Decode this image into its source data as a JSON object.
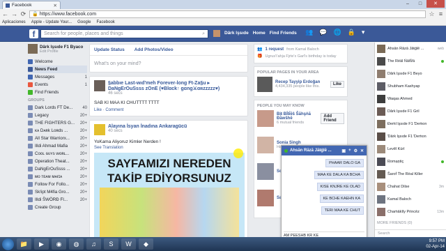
{
  "browser": {
    "tab_title": "Facebook",
    "url": "https://www.facebook.com",
    "bookmarks": [
      "Aplicaciones",
      "Apple - Update Your...",
      "Google",
      "Facebook"
    ]
  },
  "fb_header": {
    "search_placeholder": "Search for people, places and things",
    "user_name": "Dârk lşsıde",
    "home": "Home",
    "find_friends": "Find Friends"
  },
  "left": {
    "profile_name": "Dârk lşsıde F1 Byaco",
    "edit_profile": "Edit Profile",
    "items": [
      {
        "label": "Welcome",
        "count": ""
      },
      {
        "label": "News Feed",
        "count": "",
        "selected": true
      },
      {
        "label": "Messages",
        "count": "1"
      },
      {
        "label": "Events",
        "count": "1"
      },
      {
        "label": "Find Friends",
        "count": ""
      }
    ],
    "groups_title": "GROUPS",
    "groups": [
      {
        "label": "Dark Lords FT De...",
        "count": "40"
      },
      {
        "label": "Legacy",
        "count": "20+"
      },
      {
        "label": "THE FIGHTERS G...",
        "count": "20+"
      },
      {
        "label": "ᴋᴀ Dᴀʀk Lᴏʀds ...",
        "count": "20+"
      },
      {
        "label": "All Star Warriorx...",
        "count": "20+"
      },
      {
        "label": "Illdi Ahmad Mafia",
        "count": "20+"
      },
      {
        "label": "Cᴏᴏʟ ɢᴜʏs ᴡᴏʀʟ...",
        "count": "20+"
      },
      {
        "label": "Operation Theat...",
        "count": "20+"
      },
      {
        "label": "DaNgErOuSsss ...",
        "count": "20+"
      },
      {
        "label": "ᴍᴏ ᴛᴇᴀᴍ ᴍᴀғɪᴀ",
        "count": "20+"
      },
      {
        "label": "Follow For Follo...",
        "count": "20+"
      },
      {
        "label": "Sk!ipt M4fia Gro...",
        "count": "20+"
      },
      {
        "label": "Illdi ŠWÖRĐ FI...",
        "count": "20+"
      },
      {
        "label": "Create Group",
        "count": ""
      }
    ]
  },
  "composer": {
    "update_status": "Update Status",
    "add_photos": "Add Photos/Video",
    "placeholder": "What's on your mind?"
  },
  "posts": [
    {
      "author": "§abbıe Last-wıd'meh Forever-long Ft-Za§u ▸ DaNgErOuSsss zOnE (♥Blɑck↑ gɑng⚔ɑʀzzzzz♥)",
      "time": "46 secs",
      "text": "SAB KI MAA KI CHUTTTT TTTT",
      "actions": "Like · Comment"
    },
    {
      "author": "Alayına İsyan İnadına Ankaragücü",
      "time": "40 secs",
      "text": "YoKama Aliyoruz Kimler Nerden !",
      "see_translation": "See Translation",
      "banner_line1": "SAYFAMIZI NEREDEN",
      "banner_line2": "TAKİP EDİYORSUNUZ"
    }
  ],
  "right": {
    "requests": {
      "title": "1 request",
      "from": "from Kamal Baloch",
      "birthday": "Ugrus'i'ahja Fjrte'x Garl's birthday is today"
    },
    "pages_title": "POPULAR PAGES IN YOUR AREA",
    "page": {
      "name": "Recep Tayyip Erdoğan",
      "likes": "4,434,335 people like this.",
      "button": "Like"
    },
    "know_title": "PEOPLE YOU MAY KNOW",
    "people": [
      {
        "name": "Bịŧ Bḯŧḯĕŝ Ŝāhşṅā Đăwŝhĕ",
        "sub": "6 mutual friends",
        "button": "Add Friend"
      },
      {
        "name": "Sonia Singh",
        "sub": "Hanna...",
        "button": ""
      },
      {
        "name": "Sor...",
        "sub": "",
        "button": ""
      },
      {
        "name": "Sak...",
        "sub": "",
        "button": ""
      }
    ]
  },
  "chat_window": {
    "title": "Ahsān Rāzā Jāŧġlē ...",
    "messages": [
      "PHAAR DALO GA",
      "MAA KE DALA KA BCHA",
      "KISE KNJRE KE OLAD",
      "KE BCHE KAEHN KA",
      "TERI MAA KE CHUT"
    ],
    "draft": "AM PEESHB KR KE"
  },
  "chat_sidebar": {
    "contacts": [
      {
        "name": "Ahsān Rāzā Jāŧġlē ...",
        "status": "web"
      },
      {
        "name": "Ṫhe Rëāl ŃāẄā",
        "status": "online"
      },
      {
        "name": "Dârk lşsıde F1 Beyo",
        "status": ""
      },
      {
        "name": "Shubham Kashyap",
        "status": ""
      },
      {
        "name": "Waqas Ahmed",
        "status": ""
      },
      {
        "name": "Dârk lşsıde F1 Gril",
        "status": ""
      },
      {
        "name": "Ɖeṁl lşsıde F1 Ɗeṁon",
        "status": ""
      },
      {
        "name": "Ɗārk lşsıde F1 Ɗeṁon",
        "status": ""
      },
      {
        "name": "Levẽl Kürl",
        "status": ""
      },
      {
        "name": "Ṟomạṉtiç",
        "status": "online"
      },
      {
        "name": "Šaroḟ Ṫhe Rëal Killer",
        "status": ""
      },
      {
        "name": "Chahat Dilse",
        "status": "3m"
      },
      {
        "name": "Kamal Baloch",
        "status": ""
      },
      {
        "name": "Chaṁākīly Princēz",
        "status": "13m"
      }
    ],
    "more": "MORE FRIENDS (0)",
    "search": "Search"
  },
  "taskbar": {
    "time": "9:57 PM",
    "date": "02-Apr-14"
  }
}
